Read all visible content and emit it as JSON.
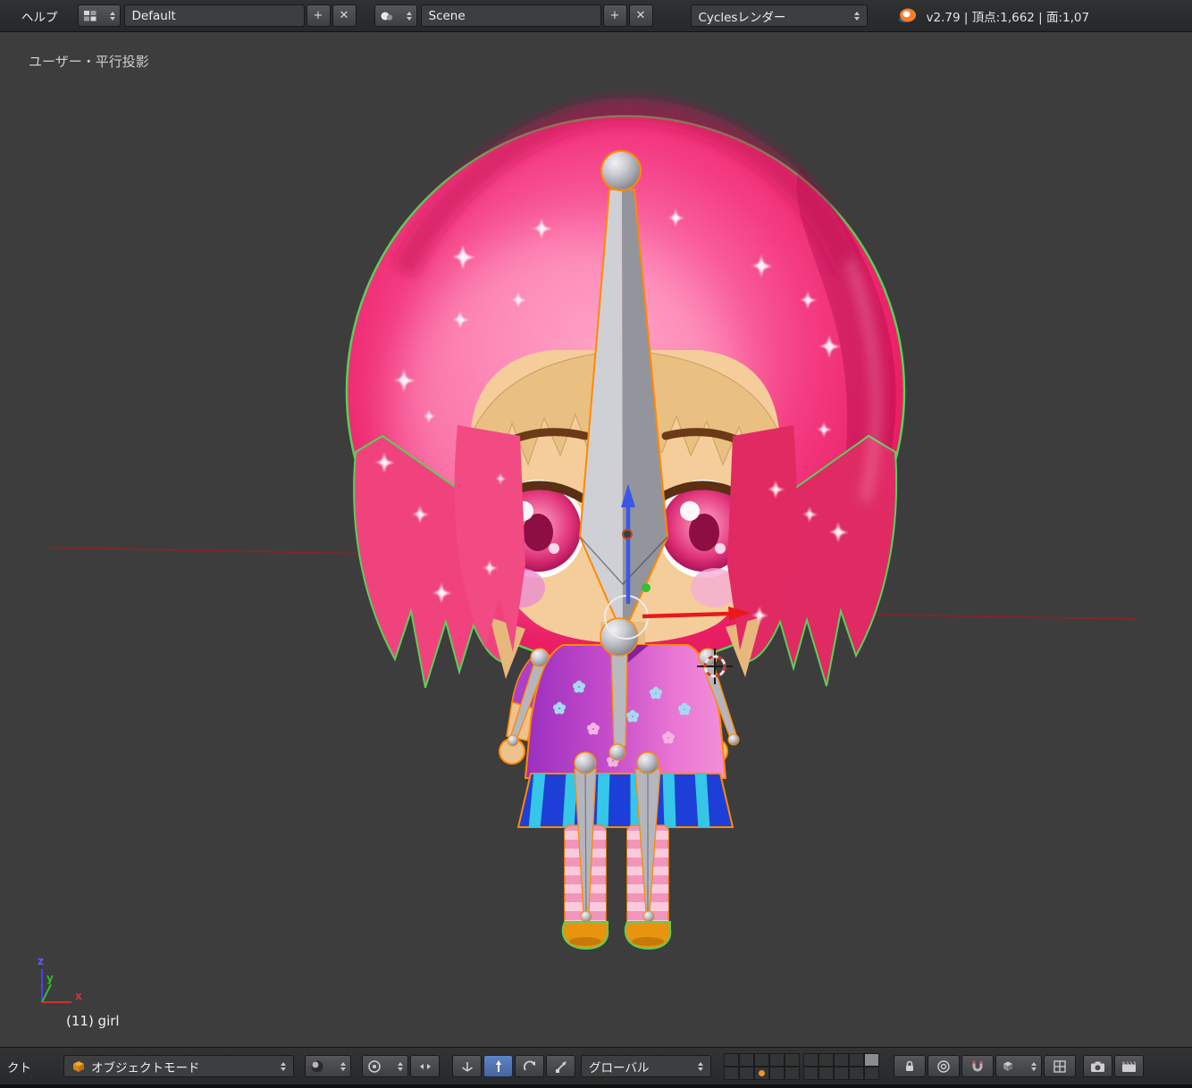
{
  "header": {
    "help_menu": "ヘルプ",
    "layout_field": "Default",
    "scene_field": "Scene",
    "engine_field": "Cyclesレンダー",
    "info_text": "v2.79 | 頂点:1,662 | 面:1,07",
    "add_icon": "+",
    "close_icon": "✕"
  },
  "viewport": {
    "view_label": "ユーザー・平行投影",
    "object_label": "(11) girl",
    "axis_x": "x",
    "axis_y": "y",
    "axis_z": "z"
  },
  "footer": {
    "clipped_menu": "クト",
    "mode_field": "オブジェクトモード",
    "orientation_field": "グローバル"
  },
  "colors": {
    "selection_outline_orange": "#ff8a00",
    "mesh_outline_green": "#58d058",
    "manipulator_x_red": "#e81919",
    "manipulator_z_blue": "#3a57e8",
    "hair_pink": "#f2256e",
    "viewport_bg": "#3d3d3d",
    "header_bg": "#28292b",
    "active_tool_blue": "#5c84c9"
  }
}
